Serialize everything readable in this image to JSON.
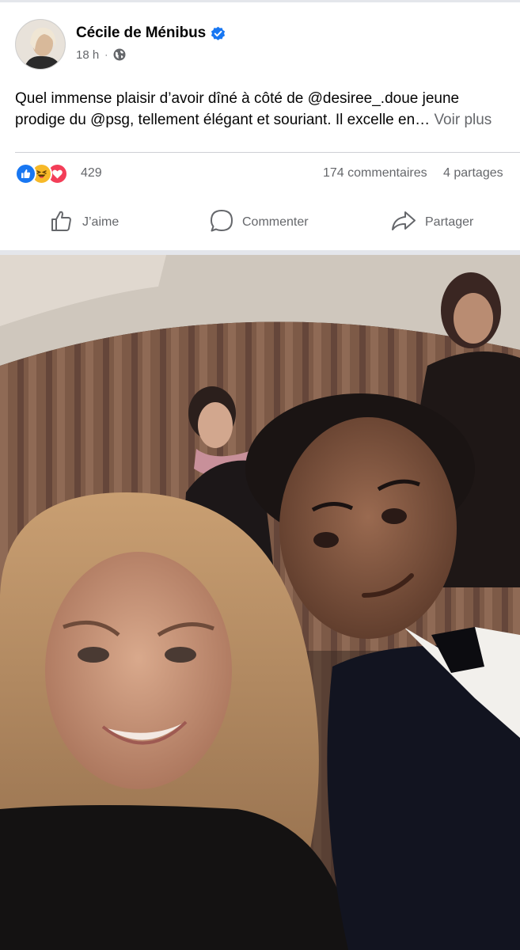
{
  "post": {
    "author": "Cécile de Ménibus",
    "verified_icon": "verified-badge-icon",
    "timestamp": "18 h",
    "privacy_icon": "globe-icon",
    "text": "Quel immense plaisir d’avoir dîné à côté de @desiree_.doue jeune prodige du @psg, tellement élégant et souriant. Il excelle en…",
    "see_more": "Voir plus"
  },
  "engagement": {
    "reaction_icons": [
      "like-icon",
      "haha-icon",
      "love-icon"
    ],
    "reaction_count": "429",
    "comments": "174 commentaires",
    "shares": "4 partages"
  },
  "actions": {
    "like": "J’aime",
    "comment": "Commenter",
    "share": "Partager"
  },
  "colors": {
    "brand_blue": "#1877f2",
    "secondary_text": "#65676b",
    "divider": "#ced0d4"
  }
}
